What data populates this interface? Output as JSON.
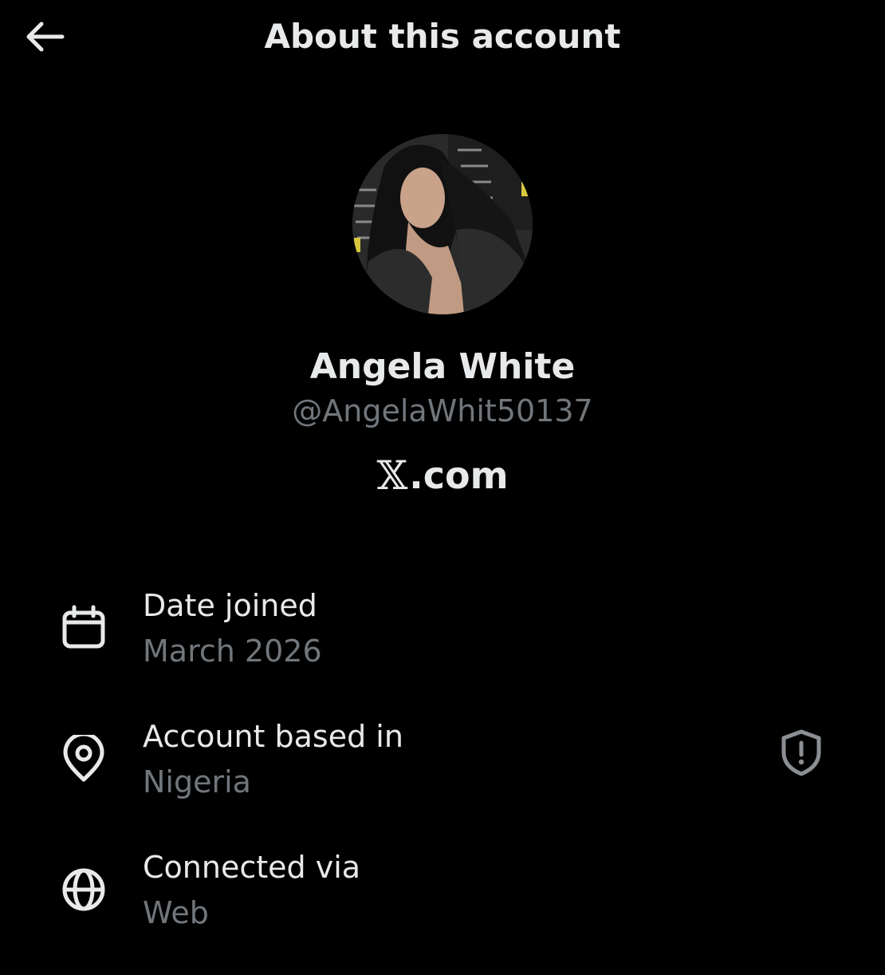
{
  "header": {
    "title": "About this account",
    "back_icon": "arrow-left-icon"
  },
  "profile": {
    "display_name": "Angela White",
    "handle": "@AngelaWhit50137",
    "platform_glyph": "𝕏",
    "platform_suffix": ".com"
  },
  "info": [
    {
      "label": "Date joined",
      "value": "March 2026",
      "icon": "calendar-icon"
    },
    {
      "label": "Account based in",
      "value": "Nigeria",
      "icon": "location-pin-icon",
      "side_icon": "shield-alert-icon"
    },
    {
      "label": "Connected via",
      "value": "Web",
      "icon": "globe-icon"
    }
  ],
  "colors": {
    "background": "#000000",
    "primary_text": "#e7e9ea",
    "secondary_text": "#71767b"
  }
}
